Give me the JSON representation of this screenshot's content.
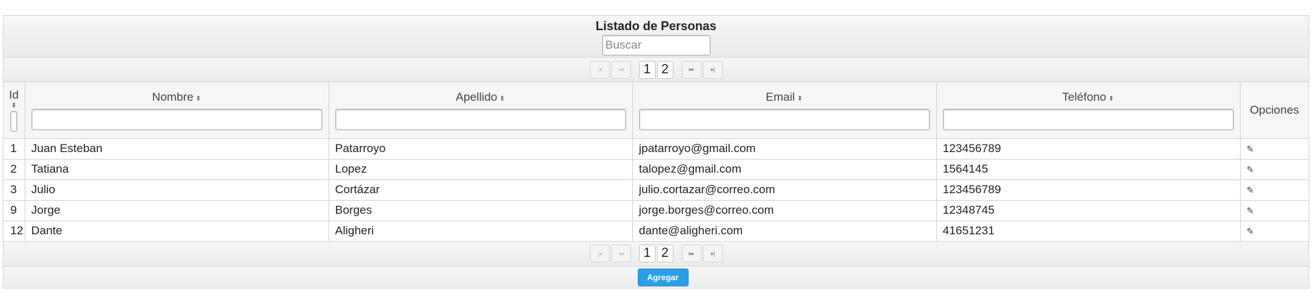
{
  "header": {
    "title": "Listado de Personas",
    "search_placeholder": "Buscar"
  },
  "pager": {
    "first_glyph": "|◂",
    "prev_glyph": "◂◂",
    "next_glyph": "▸▸",
    "last_glyph": "▸|",
    "pages": [
      "1",
      "2"
    ]
  },
  "columns": {
    "id": "Id",
    "nombre": "Nombre",
    "apellido": "Apellido",
    "email": "Email",
    "telefono": "Teléfono",
    "opciones": "Opciones",
    "sort_glyph": "⬍"
  },
  "rows": [
    {
      "id": "1",
      "nombre": "Juan Esteban",
      "apellido": "Patarroyo",
      "email": "jpatarroyo@gmail.com",
      "telefono": "123456789"
    },
    {
      "id": "2",
      "nombre": "Tatiana",
      "apellido": "Lopez",
      "email": "talopez@gmail.com",
      "telefono": "1564145"
    },
    {
      "id": "3",
      "nombre": "Julio",
      "apellido": "Cortázar",
      "email": "julio.cortazar@correo.com",
      "telefono": "123456789"
    },
    {
      "id": "9",
      "nombre": "Jorge",
      "apellido": "Borges",
      "email": "jorge.borges@correo.com",
      "telefono": "12348745"
    },
    {
      "id": "12",
      "nombre": "Dante",
      "apellido": "Aligheri",
      "email": "dante@aligheri.com",
      "telefono": "41651231"
    }
  ],
  "edit_icon": "pencil-icon",
  "footer": {
    "add_label": "Agregar"
  }
}
